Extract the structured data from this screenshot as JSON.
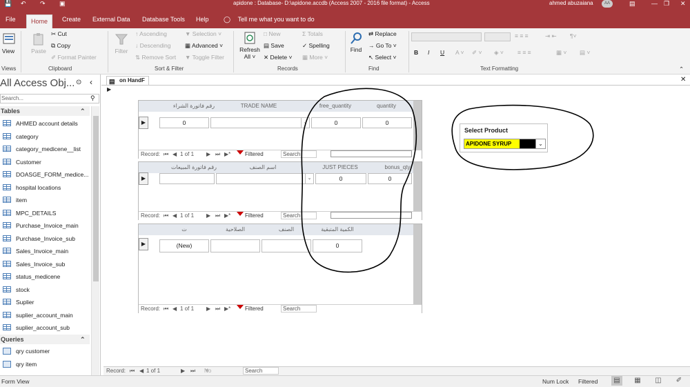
{
  "window": {
    "title": "apidone : Database- D:\\apidone.accdb (Access 2007 - 2016 file format) - Access",
    "user": "ahmed abuzaiana",
    "user_initials": "AA"
  },
  "ribbon_tabs": [
    "File",
    "Home",
    "Create",
    "External Data",
    "Database Tools",
    "Help"
  ],
  "tell_me": "Tell me what you want to do",
  "ribbon": {
    "views": {
      "view": "View",
      "group": "Views"
    },
    "clipboard": {
      "paste": "Paste",
      "cut": "Cut",
      "copy": "Copy",
      "format_painter": "Format Painter",
      "group": "Clipboard"
    },
    "sort_filter": {
      "filter": "Filter",
      "ascending": "Ascending",
      "descending": "Descending",
      "remove_sort": "Remove Sort",
      "selection": "Selection",
      "advanced": "Advanced",
      "toggle_filter": "Toggle Filter",
      "group": "Sort & Filter"
    },
    "records": {
      "refresh": "Refresh",
      "refresh2": "All",
      "new": "New",
      "save": "Save",
      "delete": "Delete",
      "totals": "Totals",
      "spelling": "Spelling",
      "more": "More",
      "group": "Records"
    },
    "find": {
      "find": "Find",
      "replace": "Replace",
      "goto": "Go To",
      "select": "Select",
      "group": "Find"
    },
    "text_formatting": {
      "group": "Text Formatting"
    }
  },
  "nav_pane": {
    "title": "All Access Obj...",
    "search_placeholder": "Search...",
    "sections": [
      {
        "name": "Tables",
        "items": [
          "AHMED account details",
          "category",
          "category_medicene__list",
          "Customer",
          "DOASGE_FORM_medice...",
          "hospital locations",
          "item",
          "MPC_DETAILS",
          "Purchase_Invoice_main",
          "Purchase_Invoice_sub",
          "Sales_Invoice_main",
          "Sales_Invoice_sub",
          "status_medicene",
          "stock",
          "Suplier",
          "suplier_account_main",
          "suplier_account_sub"
        ]
      },
      {
        "name": "Queries",
        "items": [
          "qry customer",
          "qry item"
        ]
      }
    ]
  },
  "document": {
    "tab": "on HandF"
  },
  "subforms": [
    {
      "headers": [
        "رقم فاتورة الشراء",
        "TRADE NAME",
        "free_quantity",
        "quantity"
      ],
      "values": [
        "0",
        "",
        "0",
        "0"
      ],
      "nav": {
        "record": "Record:",
        "pos": "1 of 1",
        "filtered": "Filtered",
        "search": "Search"
      }
    },
    {
      "headers": [
        "رقم فاتورة المبيعات",
        "اسم الصنف",
        "JUST PIECES",
        "bonus_qty"
      ],
      "values": [
        "",
        "",
        "0",
        "0"
      ],
      "nav": {
        "record": "Record:",
        "pos": "1 of 1",
        "filtered": "Filtered",
        "search": "Search"
      }
    },
    {
      "headers": [
        "ت",
        "الصلاحية",
        "الصنف",
        "الكمية المتبقية"
      ],
      "values": [
        "(New)",
        "",
        "",
        "0"
      ],
      "nav": {
        "record": "Record:",
        "pos": "1 of 1",
        "filtered": "Filtered",
        "search": "Search"
      }
    }
  ],
  "select_product": {
    "label": "Select Product",
    "value": "APIDONE SYRUP"
  },
  "main_nav": {
    "record": "Record:",
    "pos": "1 of 1",
    "no_filter": "No Filter",
    "search": "Search"
  },
  "status_bar": {
    "left": "Form View",
    "num_lock": "Num Lock",
    "filtered": "Filtered"
  },
  "colors": {
    "accent": "#a4373a",
    "highlight": "#ffff00",
    "filtered_bg": "#f4b6b6"
  }
}
